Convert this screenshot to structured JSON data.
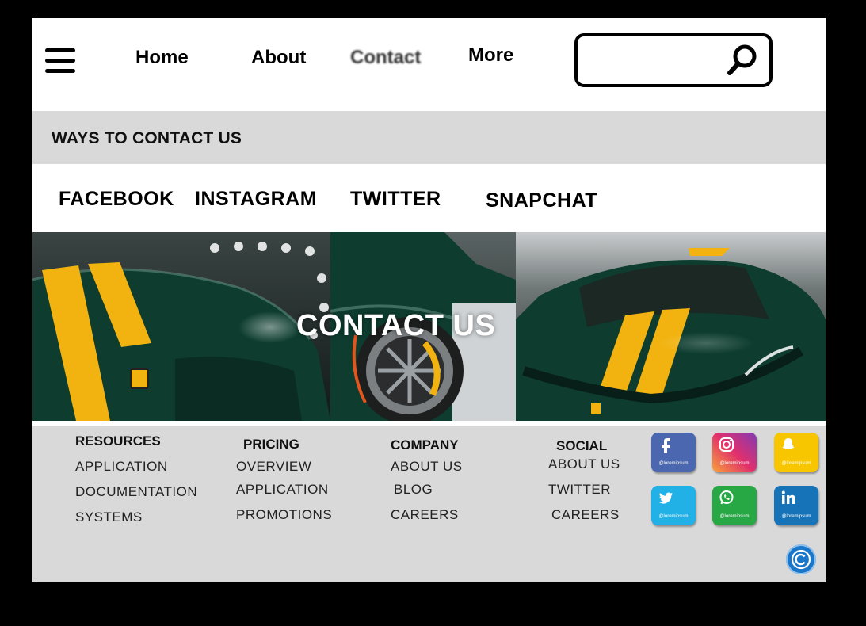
{
  "nav": {
    "links": [
      "Home",
      "About",
      "Contact",
      "More"
    ],
    "search_placeholder": ""
  },
  "ways": {
    "title": "WAYS TO CONTACT US"
  },
  "social_links": [
    "FACEBOOK",
    "INSTAGRAM",
    "TWITTER",
    "SNAPCHAT"
  ],
  "hero": {
    "title": "CONTACT US"
  },
  "footer": {
    "resources": {
      "heading": "RESOURCES",
      "items": [
        "APPLICATION",
        "DOCUMENTATION",
        "SYSTEMS"
      ]
    },
    "pricing": {
      "heading": "PRICING",
      "items": [
        "OVERVIEW",
        "APPLICATION",
        "PROMOTIONS"
      ]
    },
    "company": {
      "heading": "COMPANY",
      "items": [
        "ABOUT US",
        "BLOG",
        "CAREERS"
      ]
    },
    "social": {
      "heading": "SOCIAL",
      "items": [
        "ABOUT US",
        "TWITTER",
        "CAREERS"
      ]
    },
    "social_buttons": [
      {
        "icon": "facebook-icon",
        "handle": "@loremipsum",
        "color": "#3b5998"
      },
      {
        "icon": "instagram-icon",
        "handle": "@loremipsum",
        "color": "#d6249f"
      },
      {
        "icon": "snapchat-icon",
        "handle": "@loremipsum",
        "color": "#f7c600"
      },
      {
        "icon": "twitter-icon",
        "handle": "@loremipsum",
        "color": "#1da1f2"
      },
      {
        "icon": "whatsapp-icon",
        "handle": "@loremipsum",
        "color": "#25a140"
      },
      {
        "icon": "linkedin-icon",
        "handle": "@loremipsum",
        "color": "#0a66c2"
      }
    ]
  },
  "colors": {
    "accent_gray": "#d9d9d9",
    "car_green": "#0e3d30",
    "stripe_yellow": "#f2b310"
  }
}
